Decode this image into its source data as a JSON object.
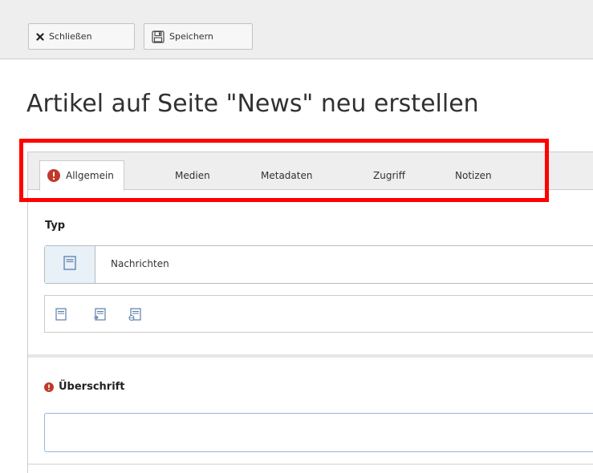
{
  "toolbar": {
    "close_label": "Schließen",
    "close_icon": "close-icon",
    "save_label": "Speichern",
    "save_icon": "save-icon"
  },
  "page_title": "Artikel auf Seite \"News\" neu erstellen",
  "tabs": [
    {
      "label": "Allgemein",
      "active": true,
      "has_error": true
    },
    {
      "label": "Medien",
      "active": false
    },
    {
      "label": "Metadaten",
      "active": false
    },
    {
      "label": "Zugriff",
      "active": false
    },
    {
      "label": "Notizen",
      "active": false
    }
  ],
  "type_field": {
    "label": "Typ",
    "selected_value": "Nachrichten",
    "options_icons": [
      "news-type-icon",
      "internal-link-type-icon",
      "external-link-type-icon"
    ]
  },
  "headline_field": {
    "label": "Überschrift",
    "required_error": true,
    "value": ""
  },
  "colors": {
    "error_red": "#c0392b",
    "highlight_box": "#ff0000",
    "toolbar_bg": "#eeeeee",
    "input_focus_border": "#93b8de"
  }
}
